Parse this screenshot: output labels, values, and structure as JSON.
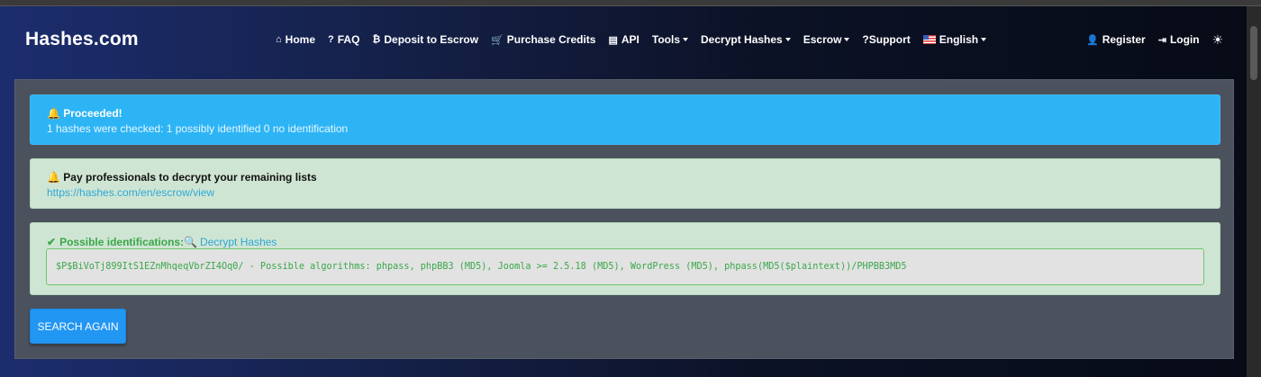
{
  "brand": "Hashes.com",
  "nav": {
    "home": "Home",
    "faq": "FAQ",
    "deposit": "Deposit to Escrow",
    "purchase": "Purchase Credits",
    "api": "API",
    "tools": "Tools",
    "decrypt": "Decrypt Hashes",
    "escrow": "Escrow",
    "support": "?Support",
    "language": "English",
    "register": "Register",
    "login": "Login"
  },
  "alerts": {
    "proceeded_title": "Proceeded!",
    "proceeded_msg": "1 hashes were checked: 1 possibly identified 0 no identification",
    "pay_title": "Pay professionals to decrypt your remaining lists",
    "pay_link": "https://hashes.com/en/escrow/view",
    "ids_label": "Possible identifications:",
    "ids_decrypt": "Decrypt Hashes",
    "result": "$P$BiVoTj899ItS1EZnMhqeqVbrZI4Oq0/ - Possible algorithms: phpass, phpBB3 (MD5), Joomla >= 2.5.18 (MD5), WordPress (MD5), phpass(MD5($plaintext))/PHPBB3MD5"
  },
  "search_again": "SEARCH AGAIN",
  "colors": {
    "info": "#2db4f5",
    "success_bg": "#cfe5d3",
    "success_text": "#3aa84a",
    "button": "#2196f3"
  },
  "icons": [
    "home-icon",
    "question-icon",
    "bitcoin-icon",
    "cart-icon",
    "api-icon",
    "flag-icon",
    "user-plus-icon",
    "sign-in-icon",
    "sun-icon",
    "bell-icon",
    "check-icon",
    "search-icon"
  ]
}
